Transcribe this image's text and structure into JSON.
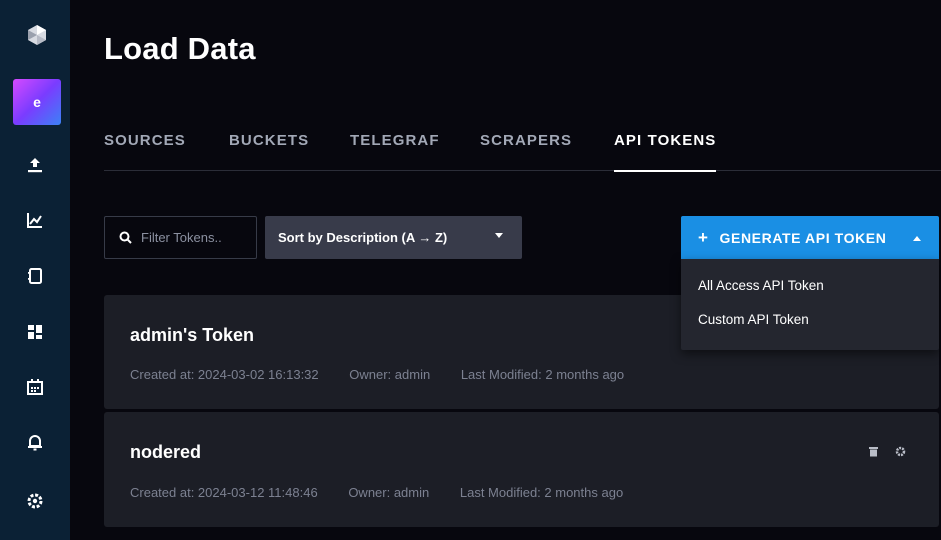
{
  "colors": {
    "background": "#07070e",
    "sidebar": "#0b2135",
    "accent": "#1a8fe4",
    "card": "#1c1e26",
    "dropdown": "#24262f"
  },
  "sidebar": {
    "logo_icon": "influx-logo-icon",
    "org_initial": "e",
    "items": [
      {
        "icon": "upload-icon"
      },
      {
        "icon": "chart-icon"
      },
      {
        "icon": "notebook-icon"
      },
      {
        "icon": "dashboards-icon"
      },
      {
        "icon": "calendar-icon"
      },
      {
        "icon": "bell-icon"
      },
      {
        "icon": "settings-icon"
      }
    ]
  },
  "page": {
    "title": "Load Data"
  },
  "tabs": [
    {
      "label": "SOURCES",
      "active": false
    },
    {
      "label": "BUCKETS",
      "active": false
    },
    {
      "label": "TELEGRAF",
      "active": false
    },
    {
      "label": "SCRAPERS",
      "active": false
    },
    {
      "label": "API TOKENS",
      "active": true
    }
  ],
  "toolbar": {
    "filter_placeholder": "Filter Tokens..",
    "sort_label": "Sort by Description (A → Z)",
    "generate_label": "GENERATE API TOKEN",
    "generate_icon": "+"
  },
  "dropdown": {
    "items": [
      "All Access API Token",
      "Custom API Token"
    ]
  },
  "tokens": [
    {
      "name": "admin's Token",
      "created": "Created at: 2024-03-02 16:13:32",
      "owner": "Owner: admin",
      "modified": "Last Modified: 2 months ago"
    },
    {
      "name": "nodered",
      "created": "Created at: 2024-03-12 11:48:46",
      "owner": "Owner: admin",
      "modified": "Last Modified: 2 months ago"
    }
  ]
}
